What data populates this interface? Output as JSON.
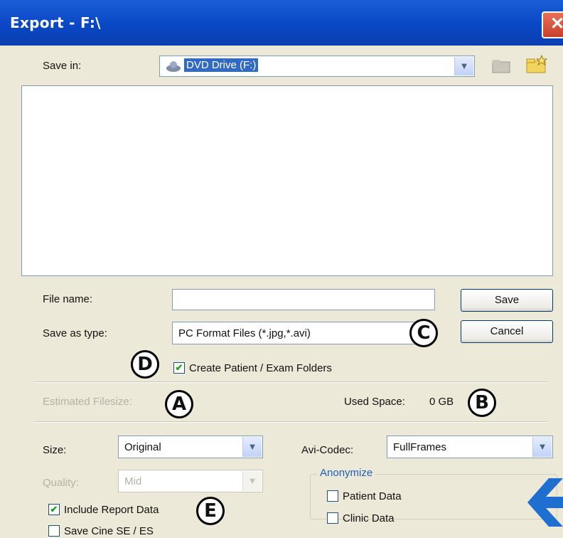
{
  "window": {
    "title": "Export - F:\\",
    "close_glyph": "✕"
  },
  "save_in": {
    "label": "Save in:",
    "value": "DVD Drive (F:)",
    "drive_icon": "dvd-drive-icon",
    "up_icon": "folder-up-icon",
    "new_folder_icon": "new-folder-icon"
  },
  "file_name": {
    "label": "File name:",
    "value": ""
  },
  "save_as_type": {
    "label": "Save as type:",
    "value": "PC Format Files (*.jpg,*.avi)"
  },
  "buttons": {
    "save": "Save",
    "cancel": "Cancel"
  },
  "create_folders": {
    "label": "Create Patient / Exam Folders",
    "checked": true
  },
  "estimated_filesize": {
    "label": "Estimated Filesize:"
  },
  "used_space": {
    "label": "Used Space:",
    "value": "0 GB"
  },
  "size": {
    "label": "Size:",
    "value": "Original"
  },
  "avi_codec": {
    "label": "Avi-Codec:",
    "value": "FullFrames"
  },
  "quality": {
    "label": "Quality:",
    "value": "Mid"
  },
  "anonymize": {
    "title": "Anonymize",
    "patient_data": "Patient Data",
    "clinic_data": "Clinic Data"
  },
  "include_report": {
    "label": "Include Report Data",
    "checked": true
  },
  "save_cine": {
    "label": "Save Cine SE / ES",
    "checked": false
  },
  "callouts": {
    "a": "A",
    "b": "B",
    "c": "C",
    "d": "D",
    "e": "E"
  },
  "colors": {
    "title_bar": "#0a47c5",
    "arrow": "#1f6fd1",
    "check": "#21a121"
  }
}
